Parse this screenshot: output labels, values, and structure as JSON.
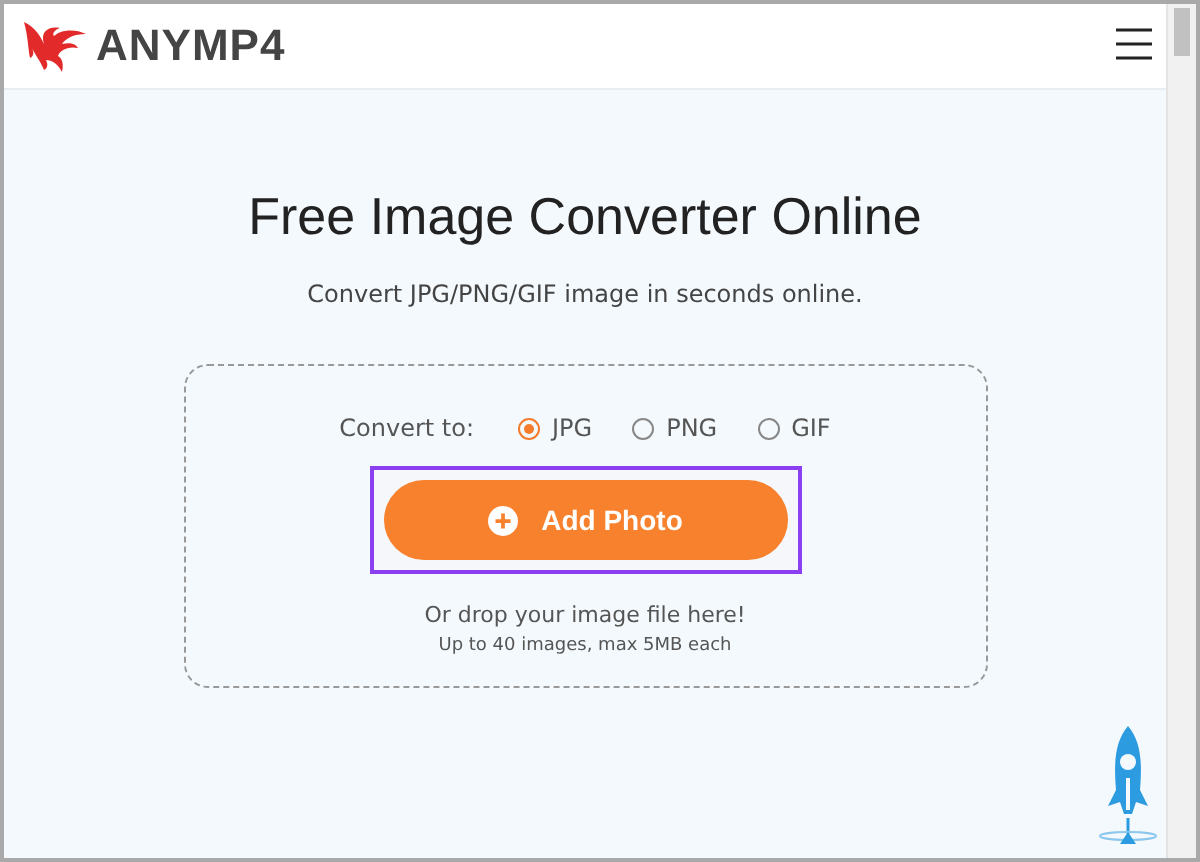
{
  "header": {
    "logo_text": "ANYMP4"
  },
  "title": "Free Image Converter Online",
  "subtitle": "Convert JPG/PNG/GIF image in seconds online.",
  "convert_label": "Convert to:",
  "formats": [
    {
      "label": "JPG",
      "selected": true
    },
    {
      "label": "PNG",
      "selected": false
    },
    {
      "label": "GIF",
      "selected": false
    }
  ],
  "add_button": {
    "label": "Add Photo",
    "highlighted": true
  },
  "drop_hint": "Or drop your image file here!",
  "limit_note": "Up to 40 images, max 5MB each"
}
